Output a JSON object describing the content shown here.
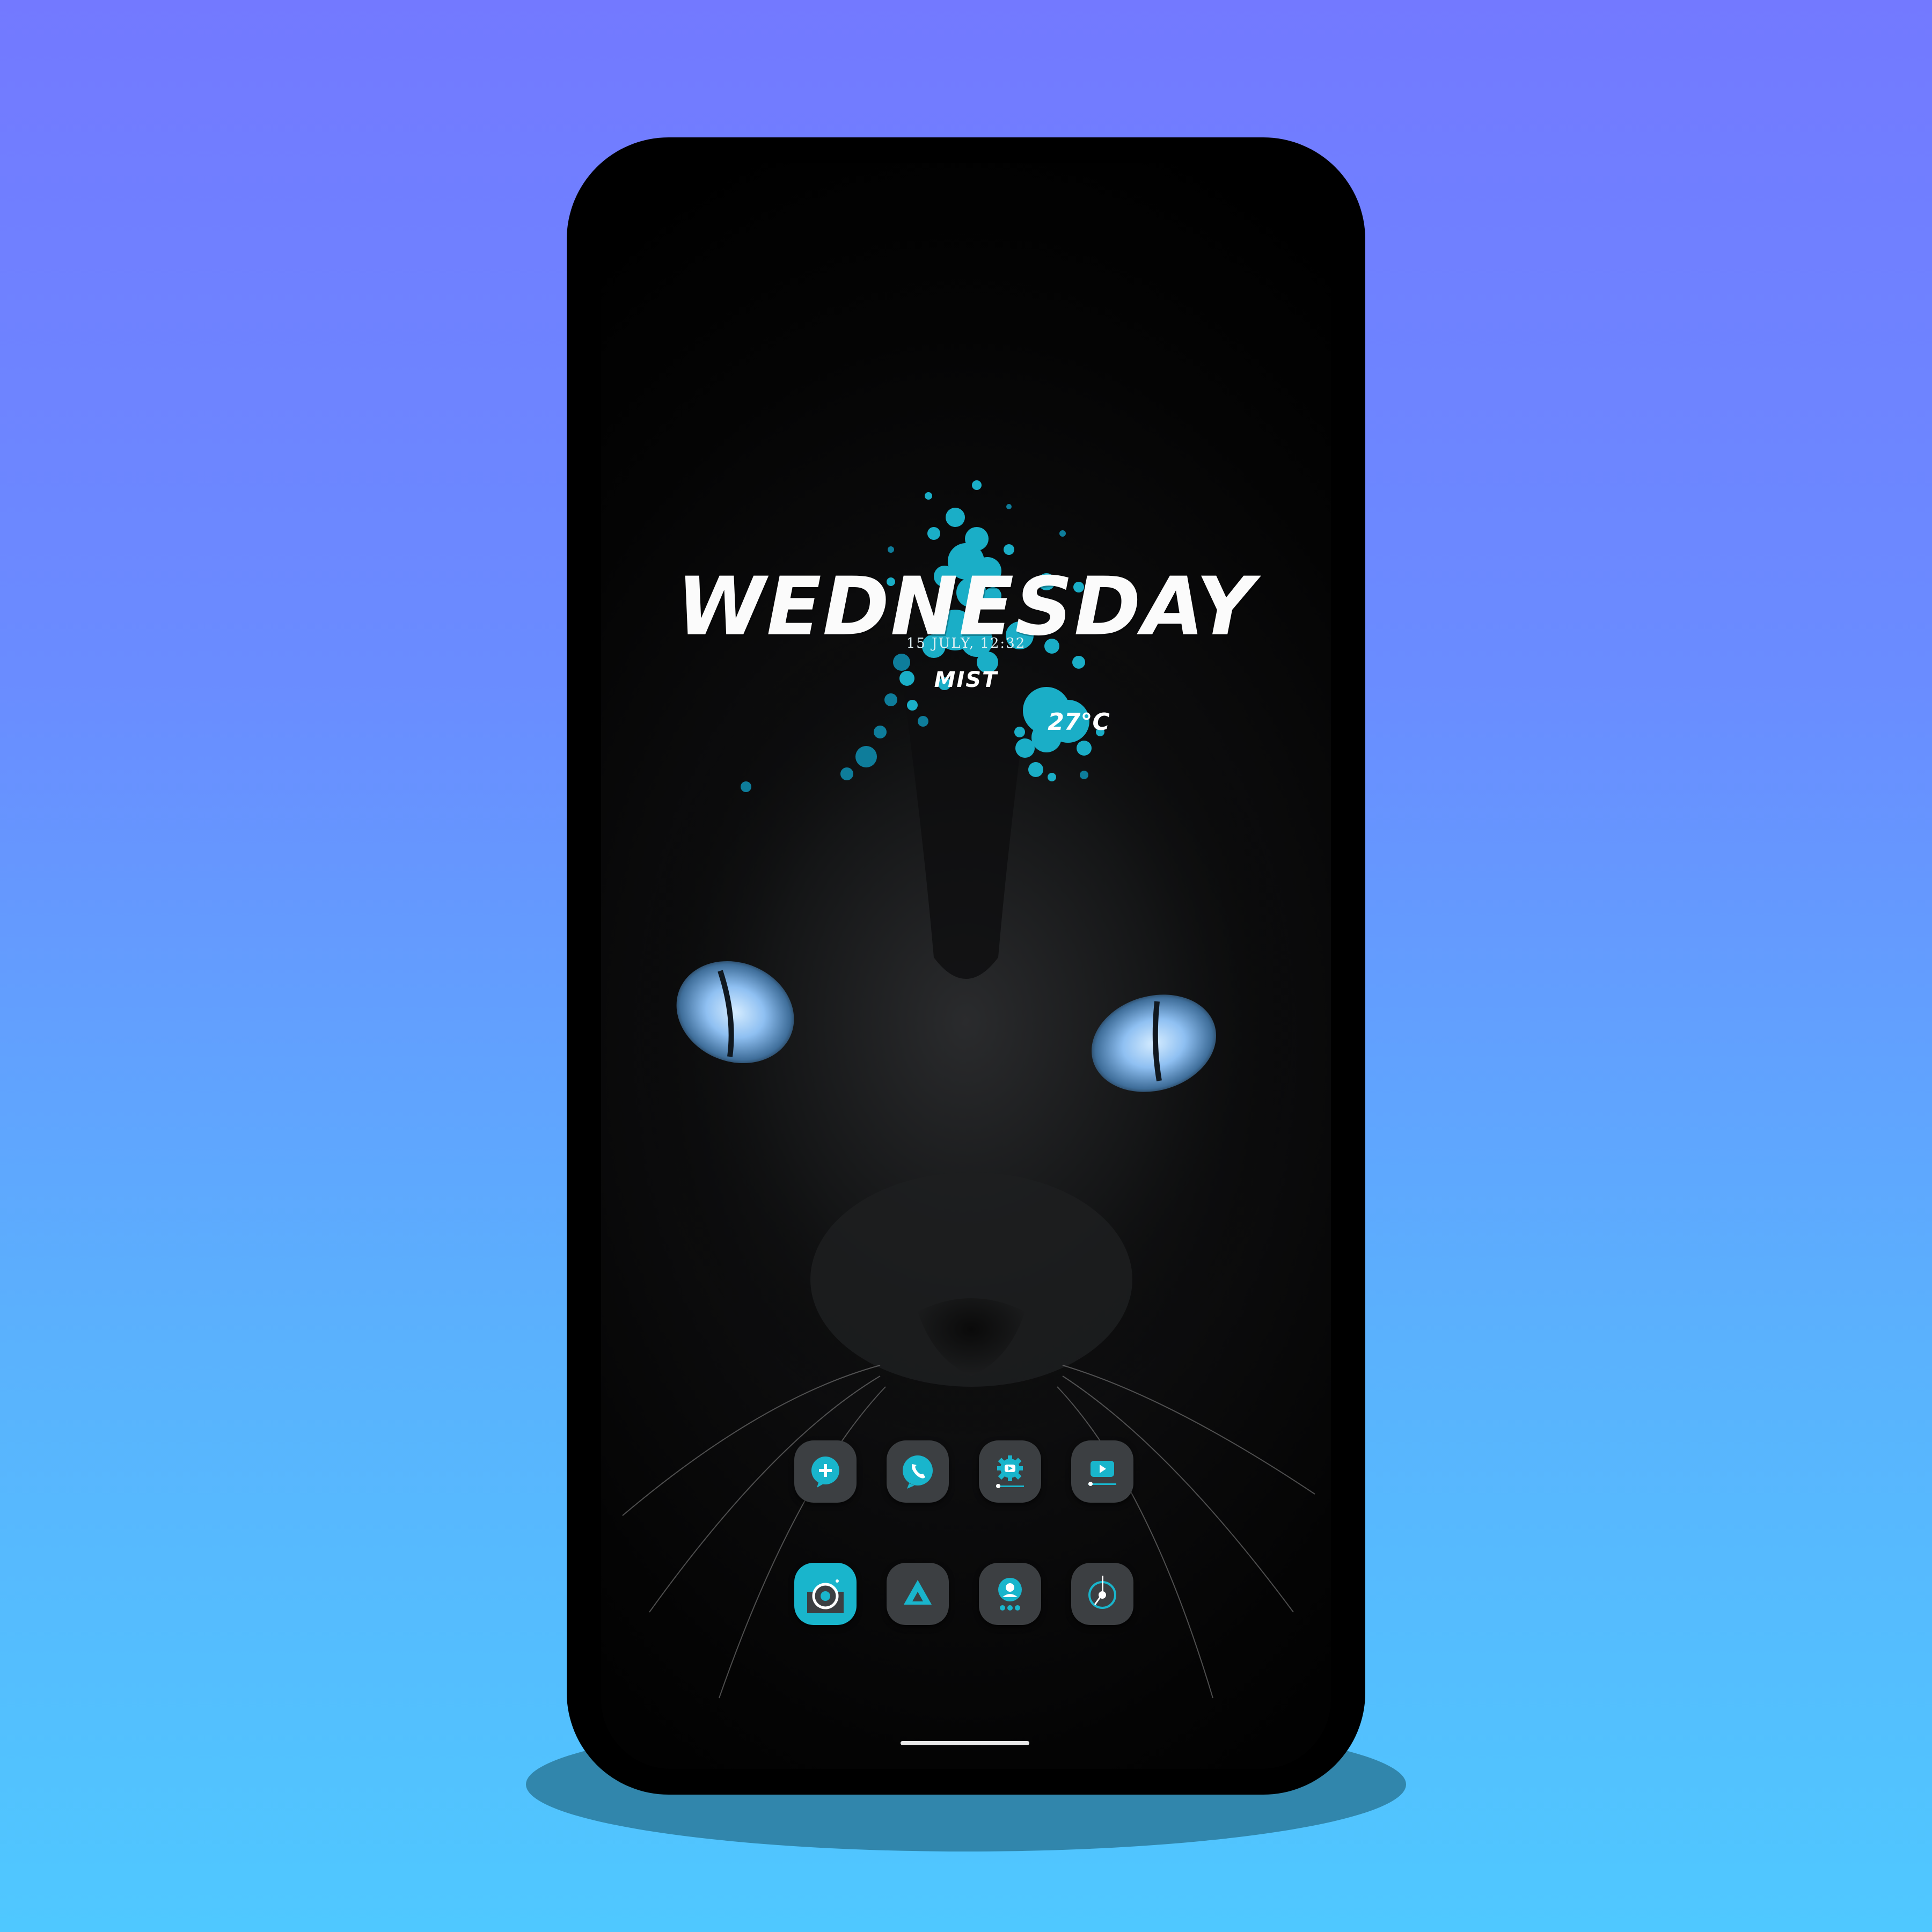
{
  "colors": {
    "accent": "#19b5cc",
    "accent_dark": "#0f7f99",
    "icon_bg": "#3c3f42",
    "eye": "#8fc0f2"
  },
  "widget": {
    "day": "WEDNESDAY",
    "date_time": "15 JULY, 12:32",
    "condition": "MIST",
    "temperature": "27°C"
  },
  "home": {
    "row1": [
      {
        "icon": "add-message-icon"
      },
      {
        "icon": "phone-call-icon"
      },
      {
        "icon": "youtube-settings-icon"
      },
      {
        "icon": "youtube-player-icon"
      }
    ],
    "row2": [
      {
        "icon": "camera-icon"
      },
      {
        "icon": "drive-icon"
      },
      {
        "icon": "contacts-icon"
      },
      {
        "icon": "clock-compass-icon"
      }
    ]
  }
}
